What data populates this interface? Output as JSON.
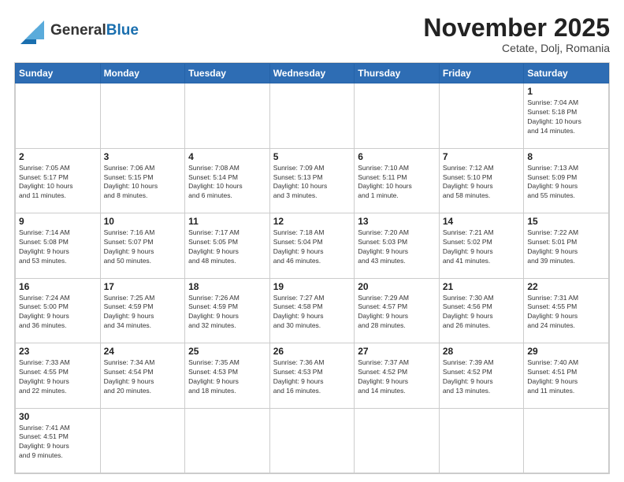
{
  "header": {
    "logo": {
      "text_general": "General",
      "text_blue": "Blue"
    },
    "title": "November 2025",
    "location": "Cetate, Dolj, Romania"
  },
  "weekdays": [
    "Sunday",
    "Monday",
    "Tuesday",
    "Wednesday",
    "Thursday",
    "Friday",
    "Saturday"
  ],
  "weeks": [
    [
      {
        "day": "",
        "info": ""
      },
      {
        "day": "",
        "info": ""
      },
      {
        "day": "",
        "info": ""
      },
      {
        "day": "",
        "info": ""
      },
      {
        "day": "",
        "info": ""
      },
      {
        "day": "",
        "info": ""
      },
      {
        "day": "1",
        "info": "Sunrise: 7:04 AM\nSunset: 5:18 PM\nDaylight: 10 hours\nand 14 minutes."
      }
    ],
    [
      {
        "day": "2",
        "info": "Sunrise: 7:05 AM\nSunset: 5:17 PM\nDaylight: 10 hours\nand 11 minutes."
      },
      {
        "day": "3",
        "info": "Sunrise: 7:06 AM\nSunset: 5:15 PM\nDaylight: 10 hours\nand 8 minutes."
      },
      {
        "day": "4",
        "info": "Sunrise: 7:08 AM\nSunset: 5:14 PM\nDaylight: 10 hours\nand 6 minutes."
      },
      {
        "day": "5",
        "info": "Sunrise: 7:09 AM\nSunset: 5:13 PM\nDaylight: 10 hours\nand 3 minutes."
      },
      {
        "day": "6",
        "info": "Sunrise: 7:10 AM\nSunset: 5:11 PM\nDaylight: 10 hours\nand 1 minute."
      },
      {
        "day": "7",
        "info": "Sunrise: 7:12 AM\nSunset: 5:10 PM\nDaylight: 9 hours\nand 58 minutes."
      },
      {
        "day": "8",
        "info": "Sunrise: 7:13 AM\nSunset: 5:09 PM\nDaylight: 9 hours\nand 55 minutes."
      }
    ],
    [
      {
        "day": "9",
        "info": "Sunrise: 7:14 AM\nSunset: 5:08 PM\nDaylight: 9 hours\nand 53 minutes."
      },
      {
        "day": "10",
        "info": "Sunrise: 7:16 AM\nSunset: 5:07 PM\nDaylight: 9 hours\nand 50 minutes."
      },
      {
        "day": "11",
        "info": "Sunrise: 7:17 AM\nSunset: 5:05 PM\nDaylight: 9 hours\nand 48 minutes."
      },
      {
        "day": "12",
        "info": "Sunrise: 7:18 AM\nSunset: 5:04 PM\nDaylight: 9 hours\nand 46 minutes."
      },
      {
        "day": "13",
        "info": "Sunrise: 7:20 AM\nSunset: 5:03 PM\nDaylight: 9 hours\nand 43 minutes."
      },
      {
        "day": "14",
        "info": "Sunrise: 7:21 AM\nSunset: 5:02 PM\nDaylight: 9 hours\nand 41 minutes."
      },
      {
        "day": "15",
        "info": "Sunrise: 7:22 AM\nSunset: 5:01 PM\nDaylight: 9 hours\nand 39 minutes."
      }
    ],
    [
      {
        "day": "16",
        "info": "Sunrise: 7:24 AM\nSunset: 5:00 PM\nDaylight: 9 hours\nand 36 minutes."
      },
      {
        "day": "17",
        "info": "Sunrise: 7:25 AM\nSunset: 4:59 PM\nDaylight: 9 hours\nand 34 minutes."
      },
      {
        "day": "18",
        "info": "Sunrise: 7:26 AM\nSunset: 4:59 PM\nDaylight: 9 hours\nand 32 minutes."
      },
      {
        "day": "19",
        "info": "Sunrise: 7:27 AM\nSunset: 4:58 PM\nDaylight: 9 hours\nand 30 minutes."
      },
      {
        "day": "20",
        "info": "Sunrise: 7:29 AM\nSunset: 4:57 PM\nDaylight: 9 hours\nand 28 minutes."
      },
      {
        "day": "21",
        "info": "Sunrise: 7:30 AM\nSunset: 4:56 PM\nDaylight: 9 hours\nand 26 minutes."
      },
      {
        "day": "22",
        "info": "Sunrise: 7:31 AM\nSunset: 4:55 PM\nDaylight: 9 hours\nand 24 minutes."
      }
    ],
    [
      {
        "day": "23",
        "info": "Sunrise: 7:33 AM\nSunset: 4:55 PM\nDaylight: 9 hours\nand 22 minutes."
      },
      {
        "day": "24",
        "info": "Sunrise: 7:34 AM\nSunset: 4:54 PM\nDaylight: 9 hours\nand 20 minutes."
      },
      {
        "day": "25",
        "info": "Sunrise: 7:35 AM\nSunset: 4:53 PM\nDaylight: 9 hours\nand 18 minutes."
      },
      {
        "day": "26",
        "info": "Sunrise: 7:36 AM\nSunset: 4:53 PM\nDaylight: 9 hours\nand 16 minutes."
      },
      {
        "day": "27",
        "info": "Sunrise: 7:37 AM\nSunset: 4:52 PM\nDaylight: 9 hours\nand 14 minutes."
      },
      {
        "day": "28",
        "info": "Sunrise: 7:39 AM\nSunset: 4:52 PM\nDaylight: 9 hours\nand 13 minutes."
      },
      {
        "day": "29",
        "info": "Sunrise: 7:40 AM\nSunset: 4:51 PM\nDaylight: 9 hours\nand 11 minutes."
      }
    ],
    [
      {
        "day": "30",
        "info": "Sunrise: 7:41 AM\nSunset: 4:51 PM\nDaylight: 9 hours\nand 9 minutes."
      },
      {
        "day": "",
        "info": ""
      },
      {
        "day": "",
        "info": ""
      },
      {
        "day": "",
        "info": ""
      },
      {
        "day": "",
        "info": ""
      },
      {
        "day": "",
        "info": ""
      },
      {
        "day": "",
        "info": ""
      }
    ]
  ]
}
